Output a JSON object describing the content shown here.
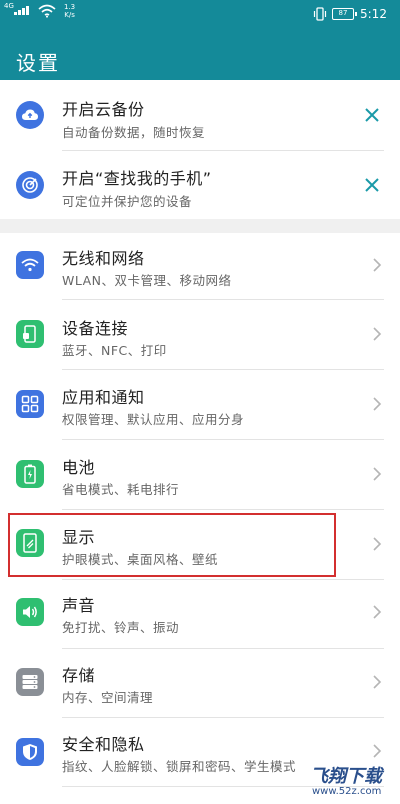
{
  "status": {
    "signal": "4G",
    "speed_value": "1.3",
    "speed_unit": "K/s",
    "battery": "87",
    "time": "5:12"
  },
  "header": {
    "title": "设置"
  },
  "cards": [
    {
      "title": "开启云备份",
      "subtitle": "自动备份数据，随时恢复",
      "icon": "cloud-backup-icon"
    },
    {
      "title": "开启“查找我的手机”",
      "subtitle": "可定位并保护您的设备",
      "icon": "find-phone-icon"
    }
  ],
  "items": [
    {
      "title": "无线和网络",
      "subtitle": "WLAN、双卡管理、移动网络",
      "icon": "wifi-icon",
      "color": "#3f73e0"
    },
    {
      "title": "设备连接",
      "subtitle": "蓝牙、NFC、打印",
      "icon": "device-connection-icon",
      "color": "#2fbf71"
    },
    {
      "title": "应用和通知",
      "subtitle": "权限管理、默认应用、应用分身",
      "icon": "apps-icon",
      "color": "#3f73e0"
    },
    {
      "title": "电池",
      "subtitle": "省电模式、耗电排行",
      "icon": "battery-icon",
      "color": "#2fbf71"
    },
    {
      "title": "显示",
      "subtitle": "护眼模式、桌面风格、壁纸",
      "icon": "display-icon",
      "color": "#2fbf71"
    },
    {
      "title": "声音",
      "subtitle": "免打扰、铃声、振动",
      "icon": "sound-icon",
      "color": "#2fbf71"
    },
    {
      "title": "存储",
      "subtitle": "内存、空间清理",
      "icon": "storage-icon",
      "color": "#8a8f96"
    },
    {
      "title": "安全和隐私",
      "subtitle": "指纹、人脸解锁、锁屏和密码、学生模式",
      "icon": "security-shield-icon",
      "color": "#3f73e0"
    }
  ],
  "watermark": {
    "brand": "飞翔下载",
    "url": "www.52z.com"
  },
  "colors": {
    "header": "#148a99",
    "accent_close": "#1a9aa8",
    "highlight_box": "#d32f2f"
  }
}
